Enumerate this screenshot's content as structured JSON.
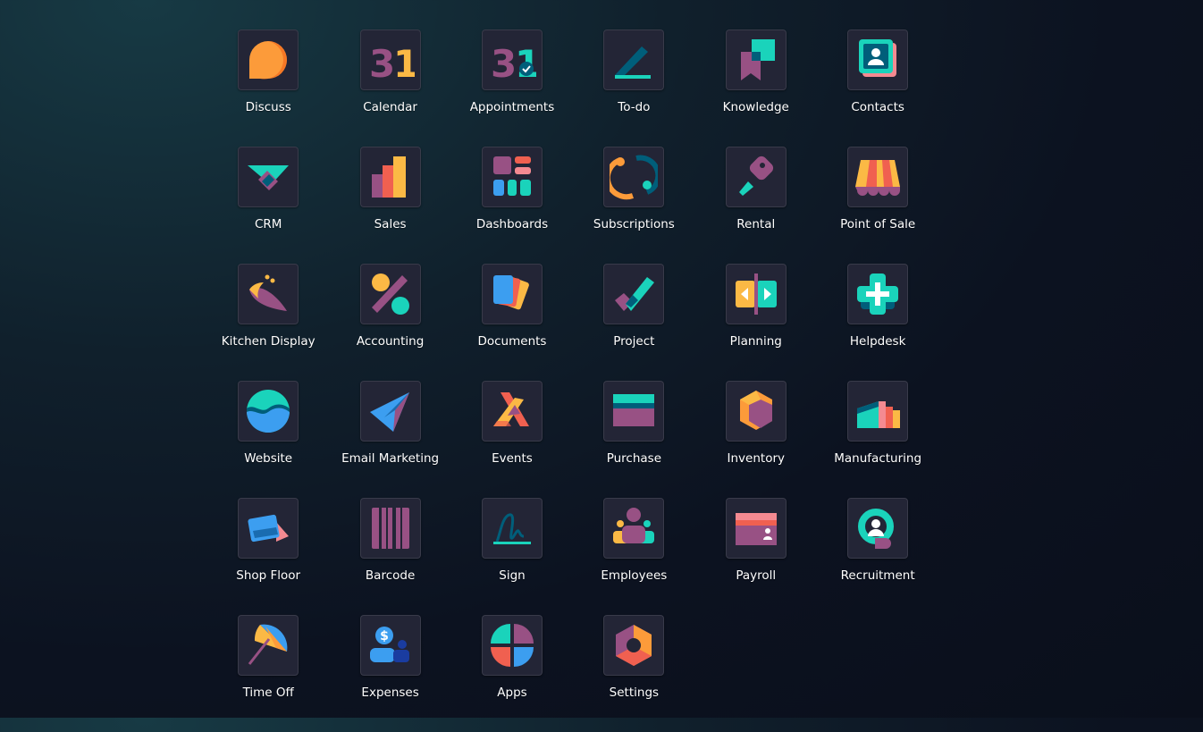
{
  "apps": [
    {
      "label": "Discuss",
      "icon": "discuss-icon"
    },
    {
      "label": "Calendar",
      "icon": "calendar-icon",
      "glyph": "31"
    },
    {
      "label": "Appointments",
      "icon": "appointments-icon",
      "glyph": "31"
    },
    {
      "label": "To-do",
      "icon": "todo-icon"
    },
    {
      "label": "Knowledge",
      "icon": "knowledge-icon"
    },
    {
      "label": "Contacts",
      "icon": "contacts-icon"
    },
    {
      "label": "CRM",
      "icon": "crm-icon"
    },
    {
      "label": "Sales",
      "icon": "sales-icon"
    },
    {
      "label": "Dashboards",
      "icon": "dashboards-icon"
    },
    {
      "label": "Subscriptions",
      "icon": "subscriptions-icon"
    },
    {
      "label": "Rental",
      "icon": "rental-icon"
    },
    {
      "label": "Point of Sale",
      "icon": "point-of-sale-icon"
    },
    {
      "label": "Kitchen Display",
      "icon": "kitchen-display-icon"
    },
    {
      "label": "Accounting",
      "icon": "accounting-icon"
    },
    {
      "label": "Documents",
      "icon": "documents-icon"
    },
    {
      "label": "Project",
      "icon": "project-icon"
    },
    {
      "label": "Planning",
      "icon": "planning-icon"
    },
    {
      "label": "Helpdesk",
      "icon": "helpdesk-icon"
    },
    {
      "label": "Website",
      "icon": "website-icon"
    },
    {
      "label": "Email Marketing",
      "icon": "email-marketing-icon"
    },
    {
      "label": "Events",
      "icon": "events-icon"
    },
    {
      "label": "Purchase",
      "icon": "purchase-icon"
    },
    {
      "label": "Inventory",
      "icon": "inventory-icon"
    },
    {
      "label": "Manufacturing",
      "icon": "manufacturing-icon"
    },
    {
      "label": "Shop Floor",
      "icon": "shop-floor-icon"
    },
    {
      "label": "Barcode",
      "icon": "barcode-icon"
    },
    {
      "label": "Sign",
      "icon": "sign-icon"
    },
    {
      "label": "Employees",
      "icon": "employees-icon"
    },
    {
      "label": "Payroll",
      "icon": "payroll-icon"
    },
    {
      "label": "Recruitment",
      "icon": "recruitment-icon"
    },
    {
      "label": "Time Off",
      "icon": "time-off-icon"
    },
    {
      "label": "Expenses",
      "icon": "expenses-icon",
      "glyph": "$"
    },
    {
      "label": "Apps",
      "icon": "apps-icon"
    },
    {
      "label": "Settings",
      "icon": "settings-icon"
    }
  ],
  "colors": {
    "tile_bg": "#232536",
    "purple": "#985184",
    "teal": "#1ad3bb",
    "orange": "#fc9b3a",
    "yellow": "#fbb945",
    "red": "#f06050",
    "blue": "#3c9ef0",
    "dark_teal": "#005e7a"
  }
}
